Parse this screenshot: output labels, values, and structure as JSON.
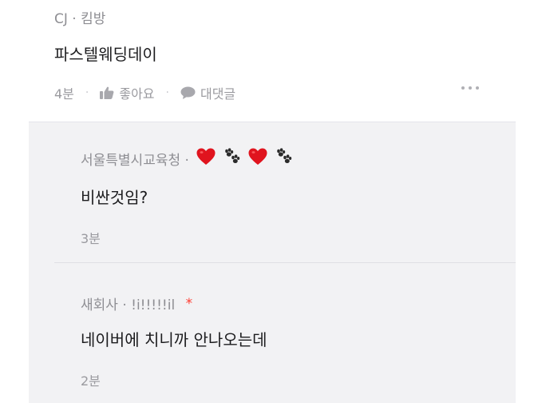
{
  "top_comment": {
    "author": "CJ · 킴방",
    "text": "파스텔웨딩데이",
    "time": "4분",
    "like_label": "좋아요",
    "reply_label": "대댓글"
  },
  "replies": [
    {
      "author": "서울특별시교육청 ·",
      "author_emoji": [
        "heart",
        "paws",
        "heart",
        "paws"
      ],
      "text": "비싼것임?",
      "time": "3분"
    },
    {
      "author": "새회사 · !i!!!!!il",
      "author_badge": "*",
      "text": "네이버에 치니까 안나오는데",
      "time": "2분"
    }
  ],
  "colors": {
    "reply_background": "#f2f2f4",
    "author_text": "#8e8e93",
    "body_text": "#1c1c1e",
    "badge_red": "#ff3b30",
    "heart_red": "#e0141e"
  }
}
